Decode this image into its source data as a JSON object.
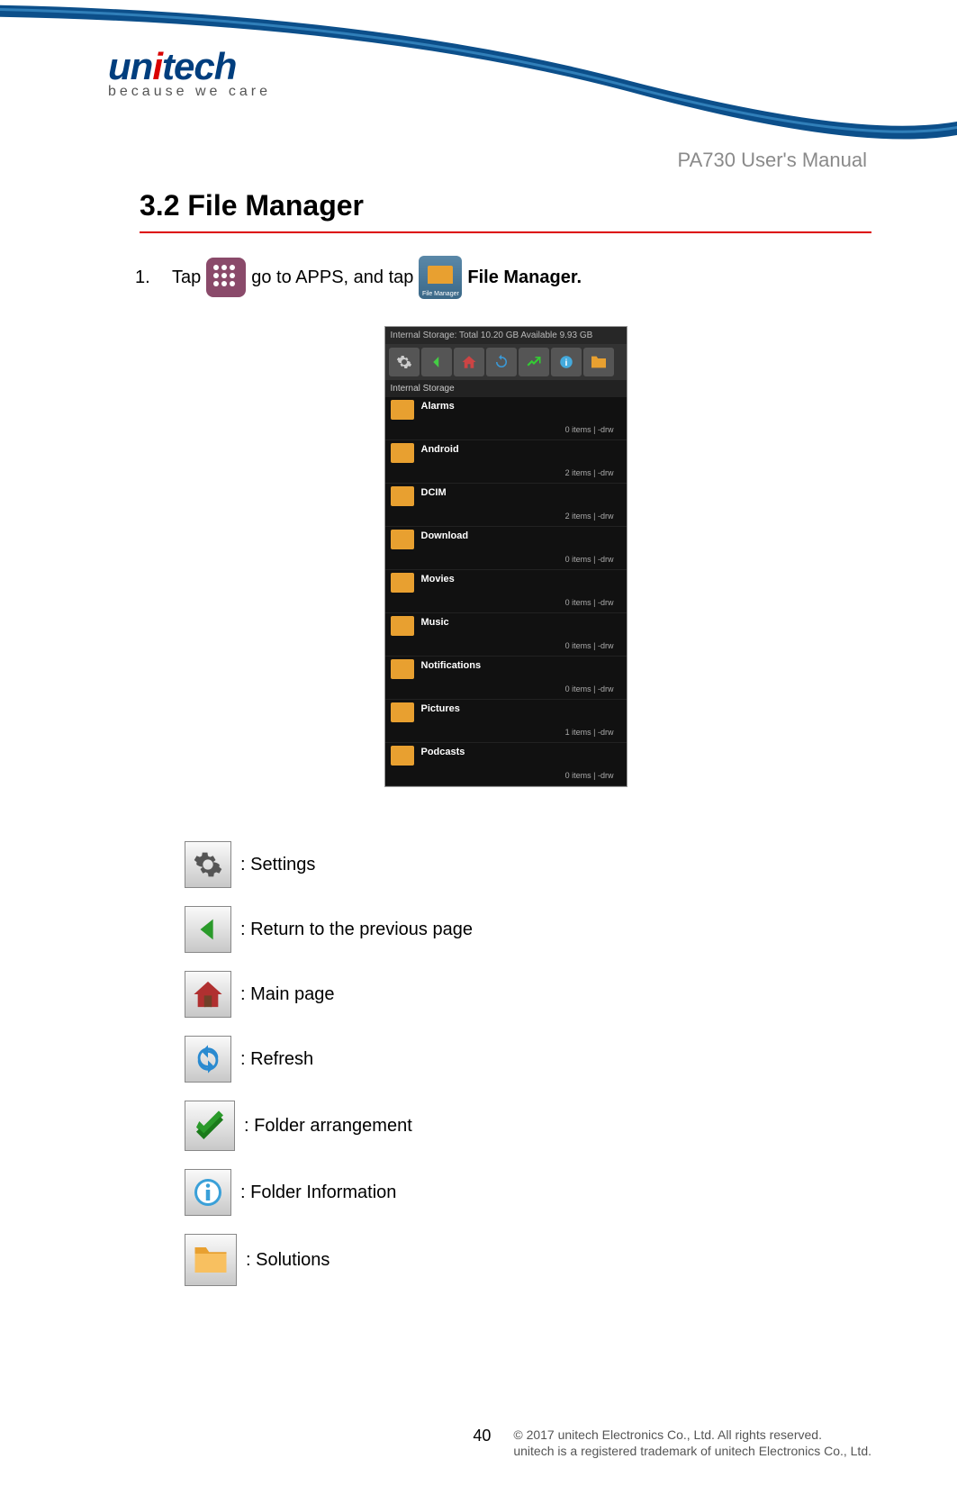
{
  "logo": {
    "main_u": "un",
    "main_i": "i",
    "main_rest": "tech",
    "tagline": "because we care"
  },
  "doc_title": "PA730 User's Manual",
  "section_title": "3.2 File Manager",
  "step": {
    "num": "1.",
    "t1": "Tap",
    "t2": "go to APPS, and tap",
    "t3": "File Manager."
  },
  "screenshot": {
    "header": "Internal Storage:  Total 10.20 GB  Available 9.93 GB",
    "path": "Internal Storage",
    "items": [
      {
        "name": "Alarms",
        "meta": "0 items | -drw"
      },
      {
        "name": "Android",
        "meta": "2 items | -drw"
      },
      {
        "name": "DCIM",
        "meta": "2 items | -drw"
      },
      {
        "name": "Download",
        "meta": "0 items | -drw"
      },
      {
        "name": "Movies",
        "meta": "0 items | -drw"
      },
      {
        "name": "Music",
        "meta": "0 items | -drw"
      },
      {
        "name": "Notifications",
        "meta": "0 items | -drw"
      },
      {
        "name": "Pictures",
        "meta": "1 items | -drw"
      },
      {
        "name": "Podcasts",
        "meta": "0 items | -drw"
      }
    ]
  },
  "legend": [
    {
      "label": ": Settings"
    },
    {
      "label": ": Return to the previous page"
    },
    {
      "label": ": Main page"
    },
    {
      "label": ": Refresh"
    },
    {
      "label": ": Folder arrangement"
    },
    {
      "label": ": Folder Information"
    },
    {
      "label": ": Solutions"
    }
  ],
  "footer": {
    "page": "40",
    "line1": "© 2017 unitech Electronics Co., Ltd. All rights reserved.",
    "line2": "unitech is a registered trademark of unitech Electronics Co., Ltd."
  }
}
